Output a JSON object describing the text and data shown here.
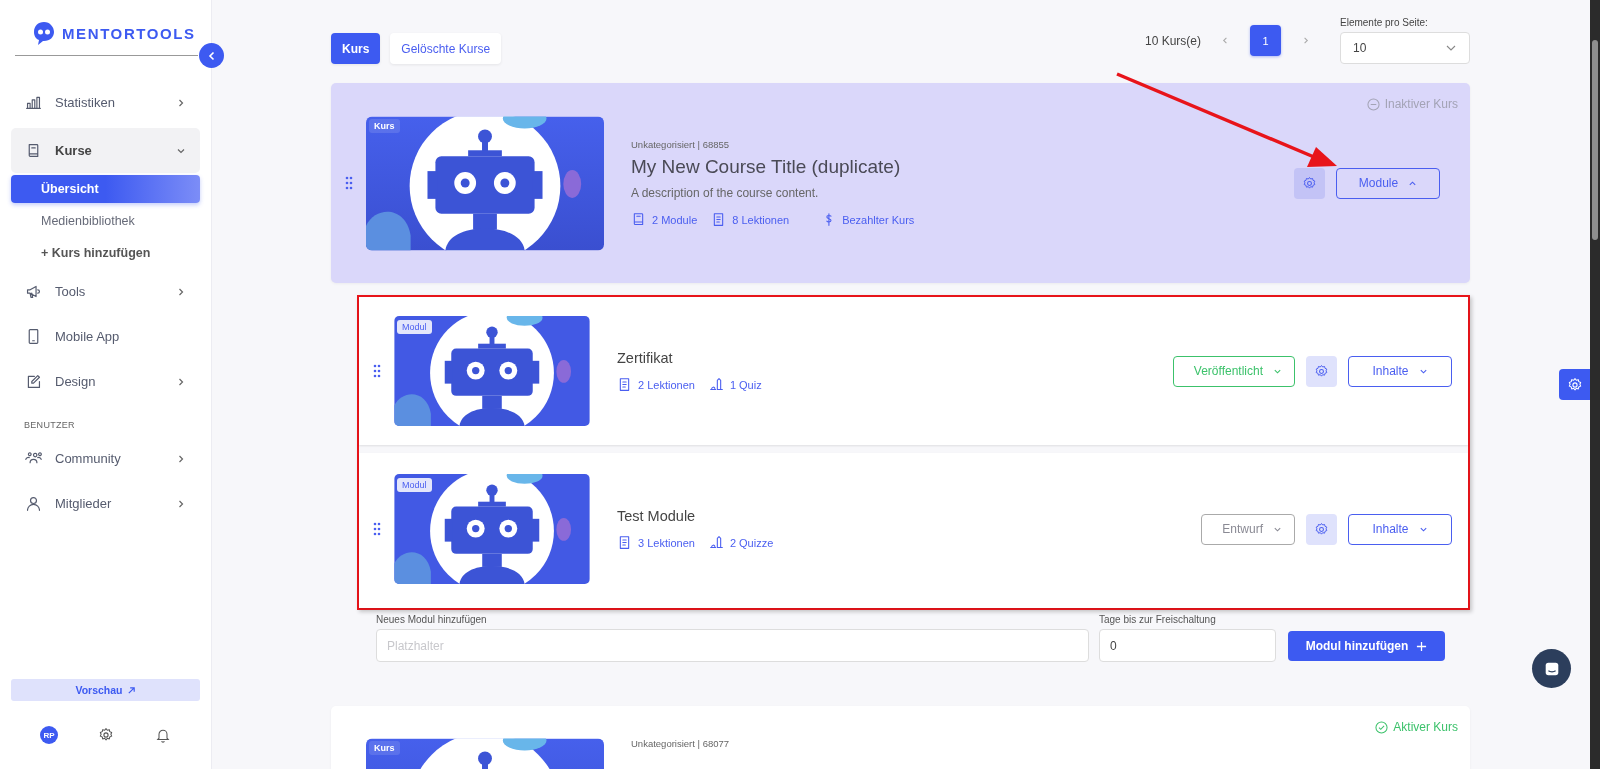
{
  "sidebar": {
    "logo": "MENTORTOOLS",
    "nav": [
      {
        "kind": "item",
        "label": "Statistiken",
        "expanded": false
      },
      {
        "kind": "item",
        "label": "Kurse",
        "expanded": true,
        "children": [
          {
            "label": "Übersicht",
            "selected": true
          },
          {
            "label": "Medienbibliothek",
            "selected": false
          },
          {
            "label": "+ Kurs hinzufügen",
            "selected": false
          }
        ]
      },
      {
        "kind": "item",
        "label": "Tools",
        "expanded": false
      },
      {
        "kind": "item",
        "label": "Mobile App"
      },
      {
        "kind": "item",
        "label": "Design",
        "expanded": false
      },
      {
        "kind": "heading",
        "label": "BENUTZER"
      },
      {
        "kind": "item",
        "label": "Community",
        "expanded": false
      },
      {
        "kind": "item",
        "label": "Mitglieder",
        "expanded": false
      }
    ],
    "preview_button": "Vorschau",
    "avatar": "RP"
  },
  "tabs": [
    {
      "label": "Kurs",
      "selected": true
    },
    {
      "label": "Gelöschte Kurse",
      "selected": false
    }
  ],
  "course_count": "10 Kurs(e)",
  "pages": [
    {
      "label": "1",
      "selected": true
    }
  ],
  "per_page": {
    "label": "Elemente pro Seite:",
    "value": "10"
  },
  "courses": [
    {
      "badge": "Kurs",
      "meta": "Unkategorisiert | 68855",
      "title": "My New Course Title (duplicate)",
      "description": "A description of the course content.",
      "stats": [
        {
          "kind": "modules",
          "label": "2 Module"
        },
        {
          "kind": "lessons",
          "label": "8 Lektionen"
        },
        {
          "kind": "paid",
          "label": "Bezahlter Kurs"
        }
      ],
      "status": {
        "kind": "inactive",
        "label": "Inaktiver Kurs"
      },
      "expanded": true,
      "toggle_button": "Module",
      "modules": [
        {
          "badge": "Modul",
          "title": "Zertifikat",
          "stats": [
            {
              "kind": "lessons",
              "label": "2 Lektionen"
            },
            {
              "kind": "quiz",
              "label": "1 Quiz"
            }
          ],
          "status": {
            "kind": "published",
            "label": "Veröffentlicht"
          },
          "content_button": "Inhalte"
        },
        {
          "badge": "Modul",
          "title": "Test Module",
          "stats": [
            {
              "kind": "lessons",
              "label": "3 Lektionen"
            },
            {
              "kind": "quiz",
              "label": "2 Quizze"
            }
          ],
          "status": {
            "kind": "draft",
            "label": "Entwurf"
          },
          "content_button": "Inhalte"
        }
      ],
      "add_module": {
        "name_label": "Neues Modul hinzufügen",
        "name_placeholder": "Platzhalter",
        "days_label": "Tage bis zur Freischaltung",
        "days_value": "0",
        "button": "Modul hinzufügen"
      }
    },
    {
      "badge": "Kurs",
      "meta": "Unkategorisiert | 68077",
      "status": {
        "kind": "active",
        "label": "Aktiver Kurs"
      },
      "expanded": false
    }
  ]
}
